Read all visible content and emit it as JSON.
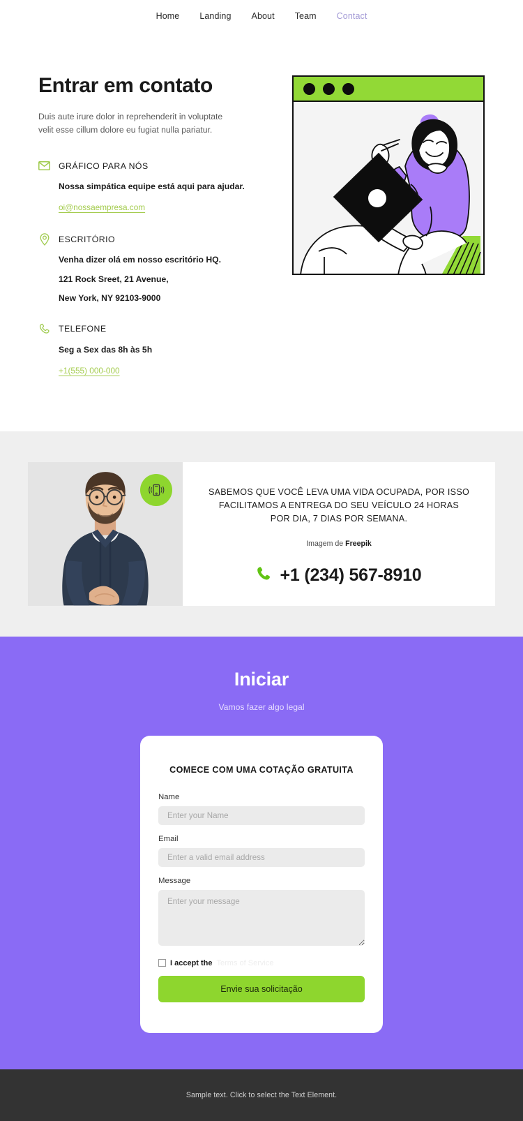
{
  "nav": {
    "items": [
      {
        "label": "Home",
        "active": false
      },
      {
        "label": "Landing",
        "active": false
      },
      {
        "label": "About",
        "active": false
      },
      {
        "label": "Team",
        "active": false
      },
      {
        "label": "Contact",
        "active": true
      }
    ]
  },
  "contact": {
    "title": "Entrar em contato",
    "subtitle": "Duis aute irure dolor in reprehenderit in voluptate velit esse cillum dolore eu fugiat nulla pariatur.",
    "blocks": [
      {
        "icon": "envelope-icon",
        "title": "GRÁFICO PARA NÓS",
        "lines": [
          "Nossa simpática equipe está aqui para ajudar."
        ],
        "link": "oi@nossaempresa.com"
      },
      {
        "icon": "map-pin-icon",
        "title": "ESCRITÓRIO",
        "lines": [
          "Venha dizer olá em nosso escritório HQ.",
          "121 Rock Sreet, 21 Avenue,",
          "New York, NY 92103-9000"
        ],
        "link": ""
      },
      {
        "icon": "phone-icon",
        "title": "TELEFONE",
        "lines": [
          "Seg a Sex das 8h às 5h"
        ],
        "link": "+1(555) 000-000"
      }
    ],
    "illustration": {
      "alt": "Pessoa com suéter roxo usando um laptop",
      "window_dots": 3
    }
  },
  "cta": {
    "headline": "SABEMOS QUE VOCÊ LEVA UMA VIDA OCUPADA, POR ISSO FACILITAMOS A ENTREGA DO SEU VEÍCULO 24 HORAS POR DIA, 7 DIAS POR SEMANA.",
    "credit_prefix": "Imagem de ",
    "credit_source": "Freepik",
    "phone": "+1 (234) 567-8910",
    "badge_icon": "mobile-ringing-icon",
    "photo_alt": "Homem barbudo de óculos com camisa azul-marinho"
  },
  "form": {
    "heading": "Iniciar",
    "subheading": "Vamos fazer algo legal",
    "card_title": "COMECE COM UMA COTAÇÃO GRATUITA",
    "fields": [
      {
        "label": "Name",
        "placeholder": "Enter your Name",
        "value": ""
      },
      {
        "label": "Email",
        "placeholder": "Enter a valid email address",
        "value": ""
      },
      {
        "label": "Message",
        "placeholder": "Enter your message",
        "value": ""
      }
    ],
    "terms_prefix": "I accept the",
    "terms_link": "Terms of Service",
    "terms_checked": false,
    "submit_label": "Envie sua solicitação"
  },
  "footer": {
    "text": "Sample text. Click to select the Text Element."
  },
  "colors": {
    "green": "#8ed62e",
    "green_link": "#a4cc4e",
    "purple": "#8a6bf5",
    "illustration_purple": "#a97cf8",
    "gray_section": "#efefef",
    "footer_bg": "#333333",
    "nav_active": "#a39ad6"
  }
}
